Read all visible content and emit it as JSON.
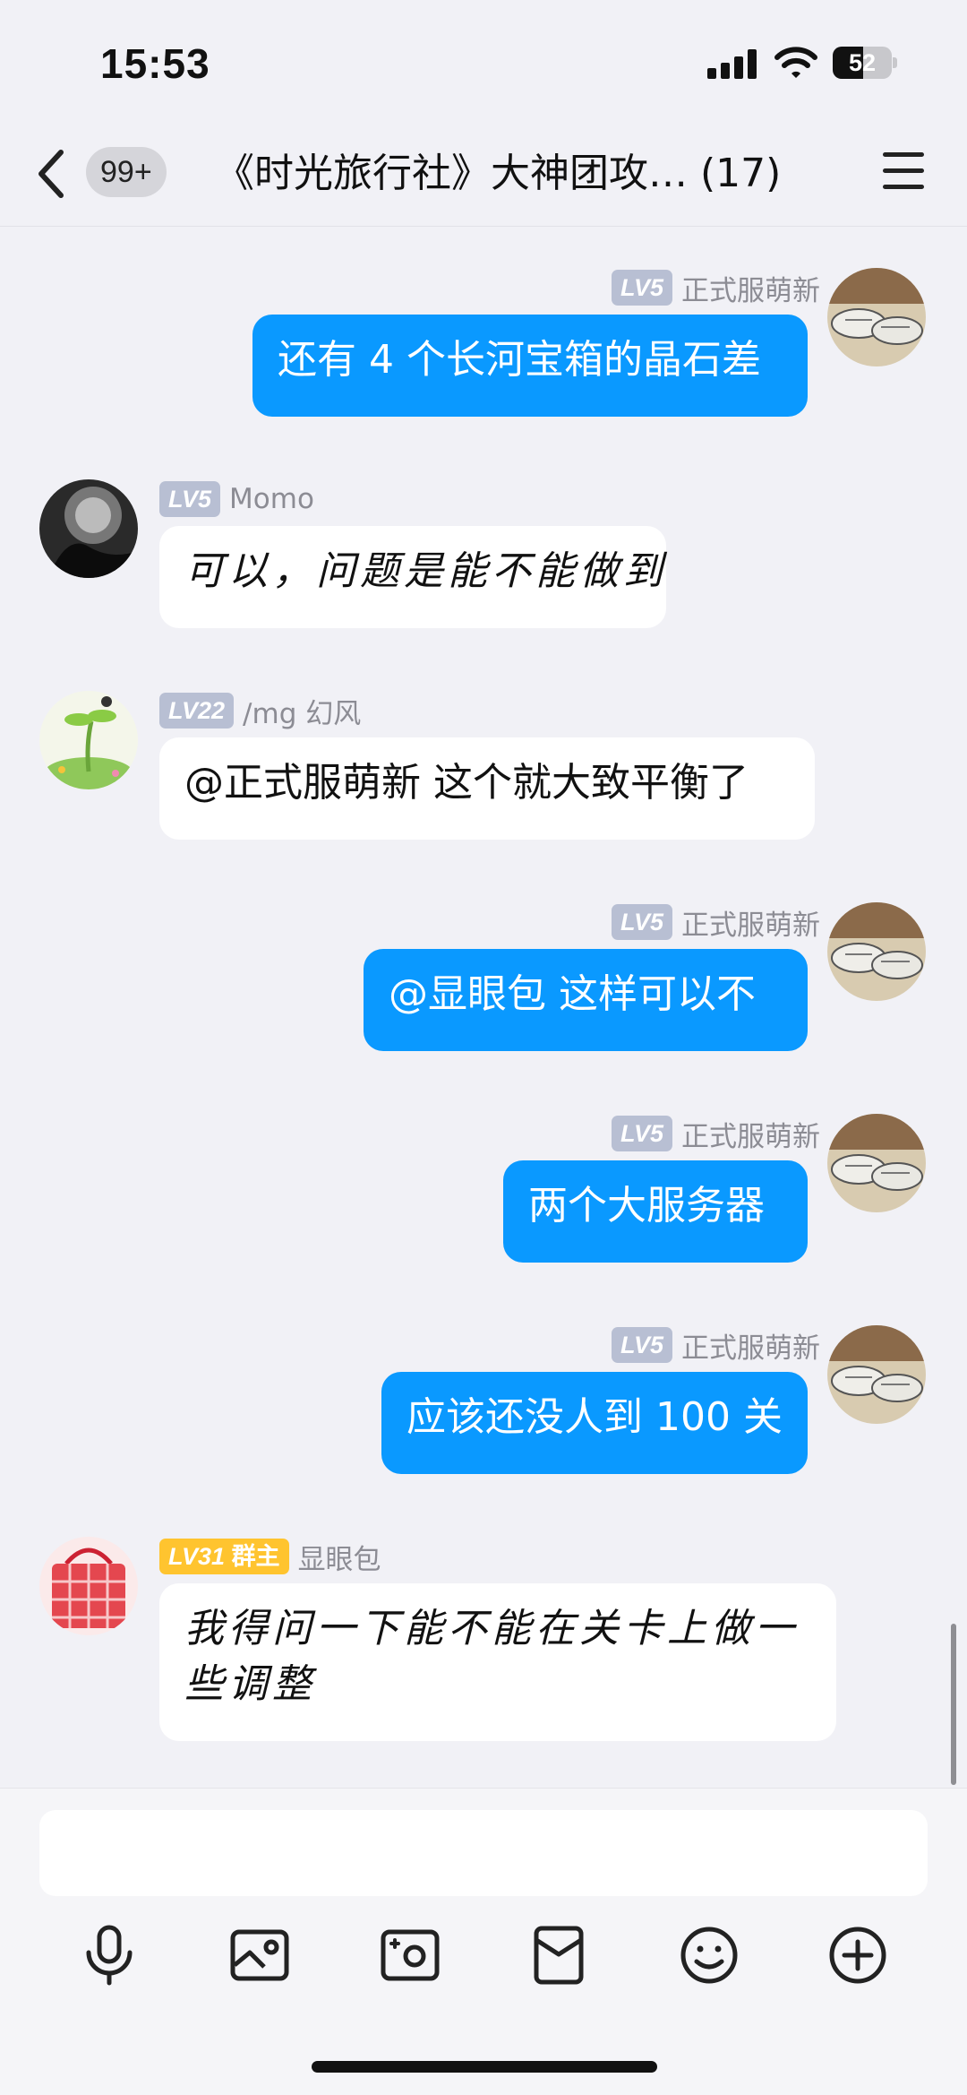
{
  "status_bar": {
    "time": "15:53",
    "battery_level": "52",
    "battery_fraction": 0.52
  },
  "nav": {
    "back_icon": "chevron-left-icon",
    "unread_count": "99+",
    "title": "《时光旅行社》大神团攻… (17)",
    "menu_icon": "hamburger-menu-icon"
  },
  "messages": [
    {
      "direction": "outgoing",
      "level": "LV5",
      "sender": "正式服萌新",
      "text": "还有 4 个长河宝箱的晶石差"
    },
    {
      "direction": "incoming",
      "level": "LV5",
      "sender": "Momo",
      "text": "可以，问题是能不能做到"
    },
    {
      "direction": "incoming",
      "level": "LV22",
      "sender": "/mg 幻风",
      "text": "@正式服萌新 这个就大致平衡了"
    },
    {
      "direction": "outgoing",
      "level": "LV5",
      "sender": "正式服萌新",
      "text": "@显眼包 这样可以不"
    },
    {
      "direction": "outgoing",
      "level": "LV5",
      "sender": "正式服萌新",
      "text": "两个大服务器"
    },
    {
      "direction": "outgoing",
      "level": "LV5",
      "sender": "正式服萌新",
      "text": "应该还没人到 100 关"
    },
    {
      "direction": "incoming",
      "level": "LV31",
      "role": "群主",
      "sender": "显眼包",
      "text": "我得问一下能不能在关卡上做一些调整"
    }
  ],
  "input": {
    "placeholder": ""
  },
  "toolbar": [
    "microphone-icon",
    "image-icon",
    "camera-icon",
    "red-packet-icon",
    "emoji-icon",
    "plus-icon"
  ],
  "colors": {
    "outgoing_bubble": "#0a99ff",
    "incoming_bubble": "#ffffff",
    "background": "#f1f1f6",
    "level_badge": "#b8bfd3",
    "owner_badge": "#ffc42f"
  }
}
